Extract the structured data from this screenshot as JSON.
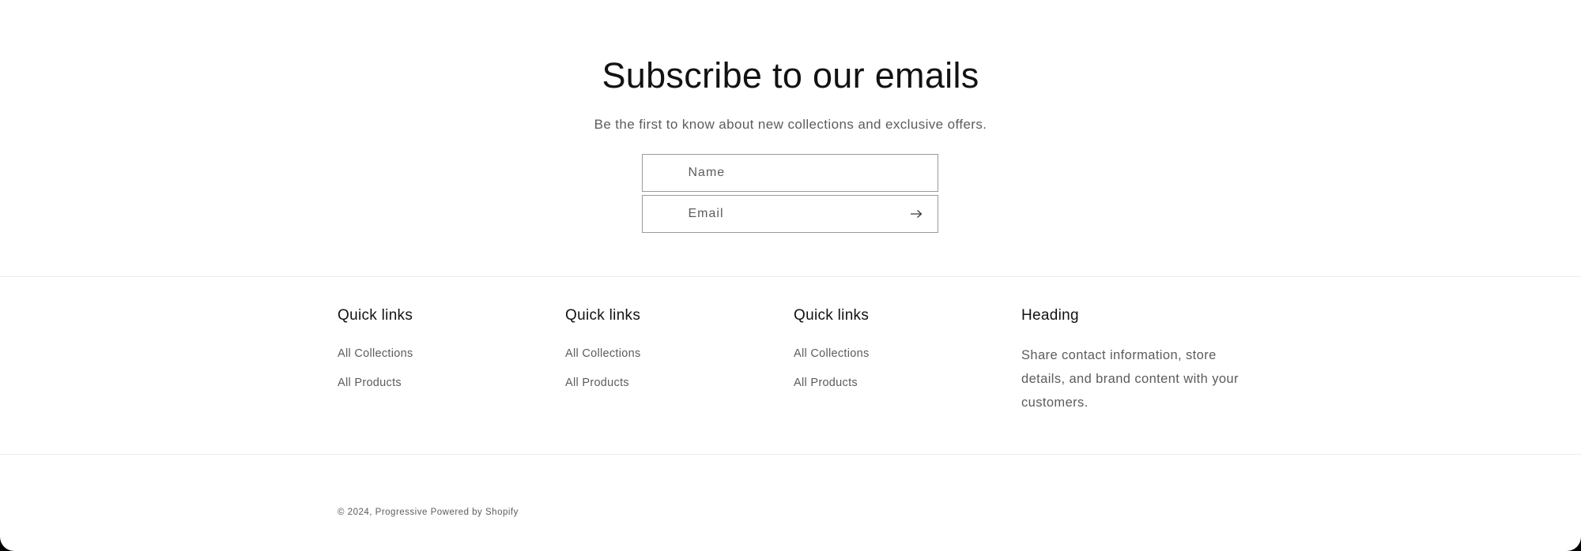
{
  "newsletter": {
    "title": "Subscribe to our emails",
    "subtitle": "Be the first to know about new collections and exclusive offers.",
    "name_placeholder": "Name",
    "email_placeholder": "Email",
    "submit_icon": "arrow-right-icon"
  },
  "footer": {
    "columns": [
      {
        "heading": "Quick links",
        "links": [
          "All Collections",
          "All Products"
        ]
      },
      {
        "heading": "Quick links",
        "links": [
          "All Collections",
          "All Products"
        ]
      },
      {
        "heading": "Quick links",
        "links": [
          "All Collections",
          "All Products"
        ]
      },
      {
        "heading": "Heading",
        "text": "Share contact information, store details, and brand content with your customers."
      }
    ],
    "copyright": {
      "prefix": "© 2024,",
      "store_name": "Progressive",
      "powered_by": "Powered by Shopify"
    }
  },
  "colors": {
    "text_primary": "#121212",
    "text_secondary": "#5c5c5c",
    "input_border": "#9a9a9a",
    "divider": "#ececec",
    "background": "#ffffff"
  }
}
